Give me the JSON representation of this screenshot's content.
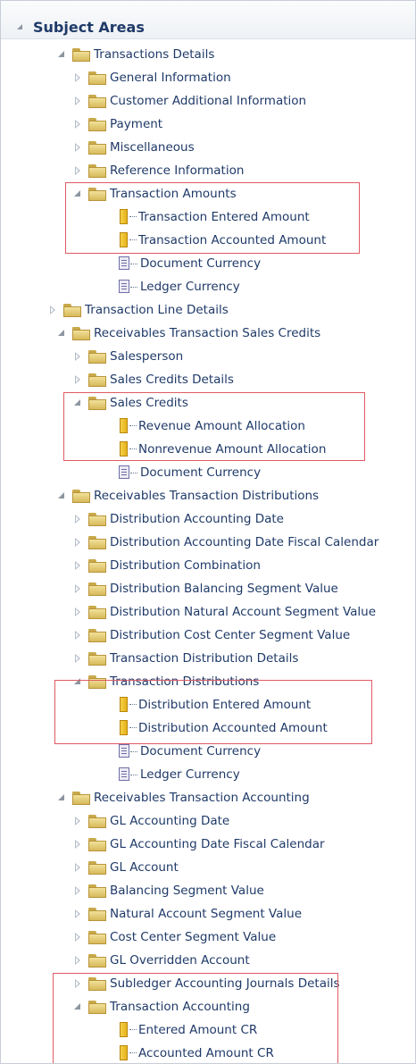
{
  "panel": {
    "title": "Subject Areas"
  },
  "tree": [
    {
      "label": "Transactions Details",
      "icon": "folder-icon",
      "state": "expanded"
    },
    {
      "label": "General Information",
      "icon": "folder-icon",
      "state": "collapsed"
    },
    {
      "label": "Customer Additional Information",
      "icon": "folder-icon",
      "state": "collapsed"
    },
    {
      "label": "Payment",
      "icon": "folder-icon",
      "state": "collapsed"
    },
    {
      "label": "Miscellaneous",
      "icon": "folder-icon",
      "state": "collapsed"
    },
    {
      "label": "Reference Information",
      "icon": "folder-icon",
      "state": "collapsed"
    },
    {
      "label": "Transaction Amounts",
      "icon": "folder-icon",
      "state": "expanded"
    },
    {
      "label": "Transaction Entered Amount",
      "icon": "measure-icon",
      "state": "leaf"
    },
    {
      "label": "Transaction Accounted Amount",
      "icon": "measure-icon",
      "state": "leaf"
    },
    {
      "label": "Document Currency",
      "icon": "attribute-icon",
      "state": "leaf"
    },
    {
      "label": "Ledger Currency",
      "icon": "attribute-icon",
      "state": "leaf"
    },
    {
      "label": "Transaction Line Details",
      "icon": "folder-icon",
      "state": "collapsed"
    },
    {
      "label": "Receivables Transaction Sales Credits",
      "icon": "folder-icon",
      "state": "expanded"
    },
    {
      "label": "Salesperson",
      "icon": "folder-icon",
      "state": "collapsed"
    },
    {
      "label": "Sales Credits Details",
      "icon": "folder-icon",
      "state": "collapsed"
    },
    {
      "label": "Sales Credits",
      "icon": "folder-icon",
      "state": "expanded"
    },
    {
      "label": "Revenue Amount Allocation",
      "icon": "measure-icon",
      "state": "leaf"
    },
    {
      "label": "Nonrevenue Amount Allocation",
      "icon": "measure-icon",
      "state": "leaf"
    },
    {
      "label": "Document Currency",
      "icon": "attribute-icon",
      "state": "leaf"
    },
    {
      "label": "Receivables Transaction Distributions",
      "icon": "folder-icon",
      "state": "expanded"
    },
    {
      "label": "Distribution Accounting Date",
      "icon": "folder-icon",
      "state": "collapsed"
    },
    {
      "label": "Distribution Accounting Date Fiscal Calendar",
      "icon": "folder-icon",
      "state": "collapsed"
    },
    {
      "label": "Distribution Combination",
      "icon": "folder-icon",
      "state": "collapsed"
    },
    {
      "label": "Distribution Balancing Segment Value",
      "icon": "folder-icon",
      "state": "collapsed"
    },
    {
      "label": "Distribution Natural Account Segment Value",
      "icon": "folder-icon",
      "state": "collapsed"
    },
    {
      "label": "Distribution Cost Center Segment Value",
      "icon": "folder-icon",
      "state": "collapsed"
    },
    {
      "label": "Transaction Distribution Details",
      "icon": "folder-icon",
      "state": "collapsed"
    },
    {
      "label": "Transaction Distributions",
      "icon": "folder-icon",
      "state": "expanded"
    },
    {
      "label": "Distribution Entered Amount",
      "icon": "measure-icon",
      "state": "leaf"
    },
    {
      "label": "Distribution Accounted Amount",
      "icon": "measure-icon",
      "state": "leaf"
    },
    {
      "label": "Document Currency",
      "icon": "attribute-icon",
      "state": "leaf"
    },
    {
      "label": "Ledger Currency",
      "icon": "attribute-icon",
      "state": "leaf"
    },
    {
      "label": "Receivables Transaction Accounting",
      "icon": "folder-icon",
      "state": "expanded"
    },
    {
      "label": "GL Accounting Date",
      "icon": "folder-icon",
      "state": "collapsed"
    },
    {
      "label": "GL Accounting Date Fiscal Calendar",
      "icon": "folder-icon",
      "state": "collapsed"
    },
    {
      "label": "GL Account",
      "icon": "folder-icon",
      "state": "collapsed"
    },
    {
      "label": "Balancing Segment Value",
      "icon": "folder-icon",
      "state": "collapsed"
    },
    {
      "label": "Natural Account Segment Value",
      "icon": "folder-icon",
      "state": "collapsed"
    },
    {
      "label": "Cost Center Segment Value",
      "icon": "folder-icon",
      "state": "collapsed"
    },
    {
      "label": "GL Overridden Account",
      "icon": "folder-icon",
      "state": "collapsed"
    },
    {
      "label": "Subledger Accounting Journals Details",
      "icon": "folder-icon",
      "state": "collapsed"
    },
    {
      "label": "Transaction Accounting",
      "icon": "folder-icon",
      "state": "expanded"
    },
    {
      "label": "Entered Amount CR",
      "icon": "measure-icon",
      "state": "leaf"
    },
    {
      "label": "Accounted Amount CR",
      "icon": "measure-icon",
      "state": "leaf"
    }
  ],
  "colors": {
    "label": "#1f3a68",
    "highlight": "#e05a63"
  }
}
